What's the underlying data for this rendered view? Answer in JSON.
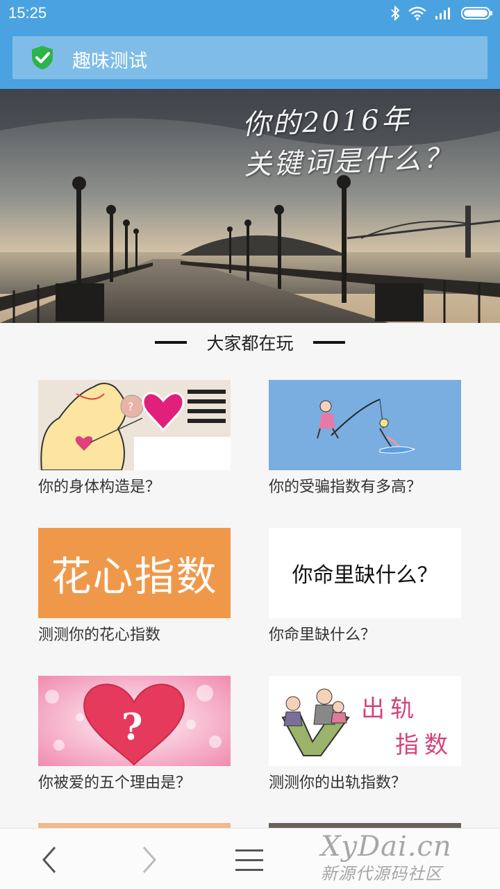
{
  "status_bar": {
    "time": "15:25"
  },
  "header": {
    "title": "趣味测试",
    "icon": "shield-check-icon"
  },
  "banner": {
    "line1": "你的2016年",
    "line2": "关键词是什么？"
  },
  "section": {
    "title": "大家都在玩"
  },
  "cards": [
    {
      "label": "你的身体构造是？"
    },
    {
      "label": "你的受骗指数有多高？"
    },
    {
      "label": "测测你的花心指数",
      "thumb_text": "花心指数"
    },
    {
      "label": "你命里缺什么？",
      "thumb_text": "你命里缺什么？"
    },
    {
      "label": "你被爱的五个理由是？",
      "thumb_text": "?"
    },
    {
      "label": "测测你的出轨指数？",
      "thumb_text_1": "出轨",
      "thumb_text_2": "指数"
    }
  ],
  "bottom_nav": {
    "back": "back-chevron-icon",
    "forward": "forward-chevron-icon",
    "menu": "menu-icon"
  },
  "watermark": {
    "line1": "XyDai.cn",
    "line2": "新源代源码社区"
  },
  "colors": {
    "header": "#4aa3e0",
    "title_box": "#7fbde8",
    "orange": "#f0984a",
    "blue": "#7aade0"
  }
}
